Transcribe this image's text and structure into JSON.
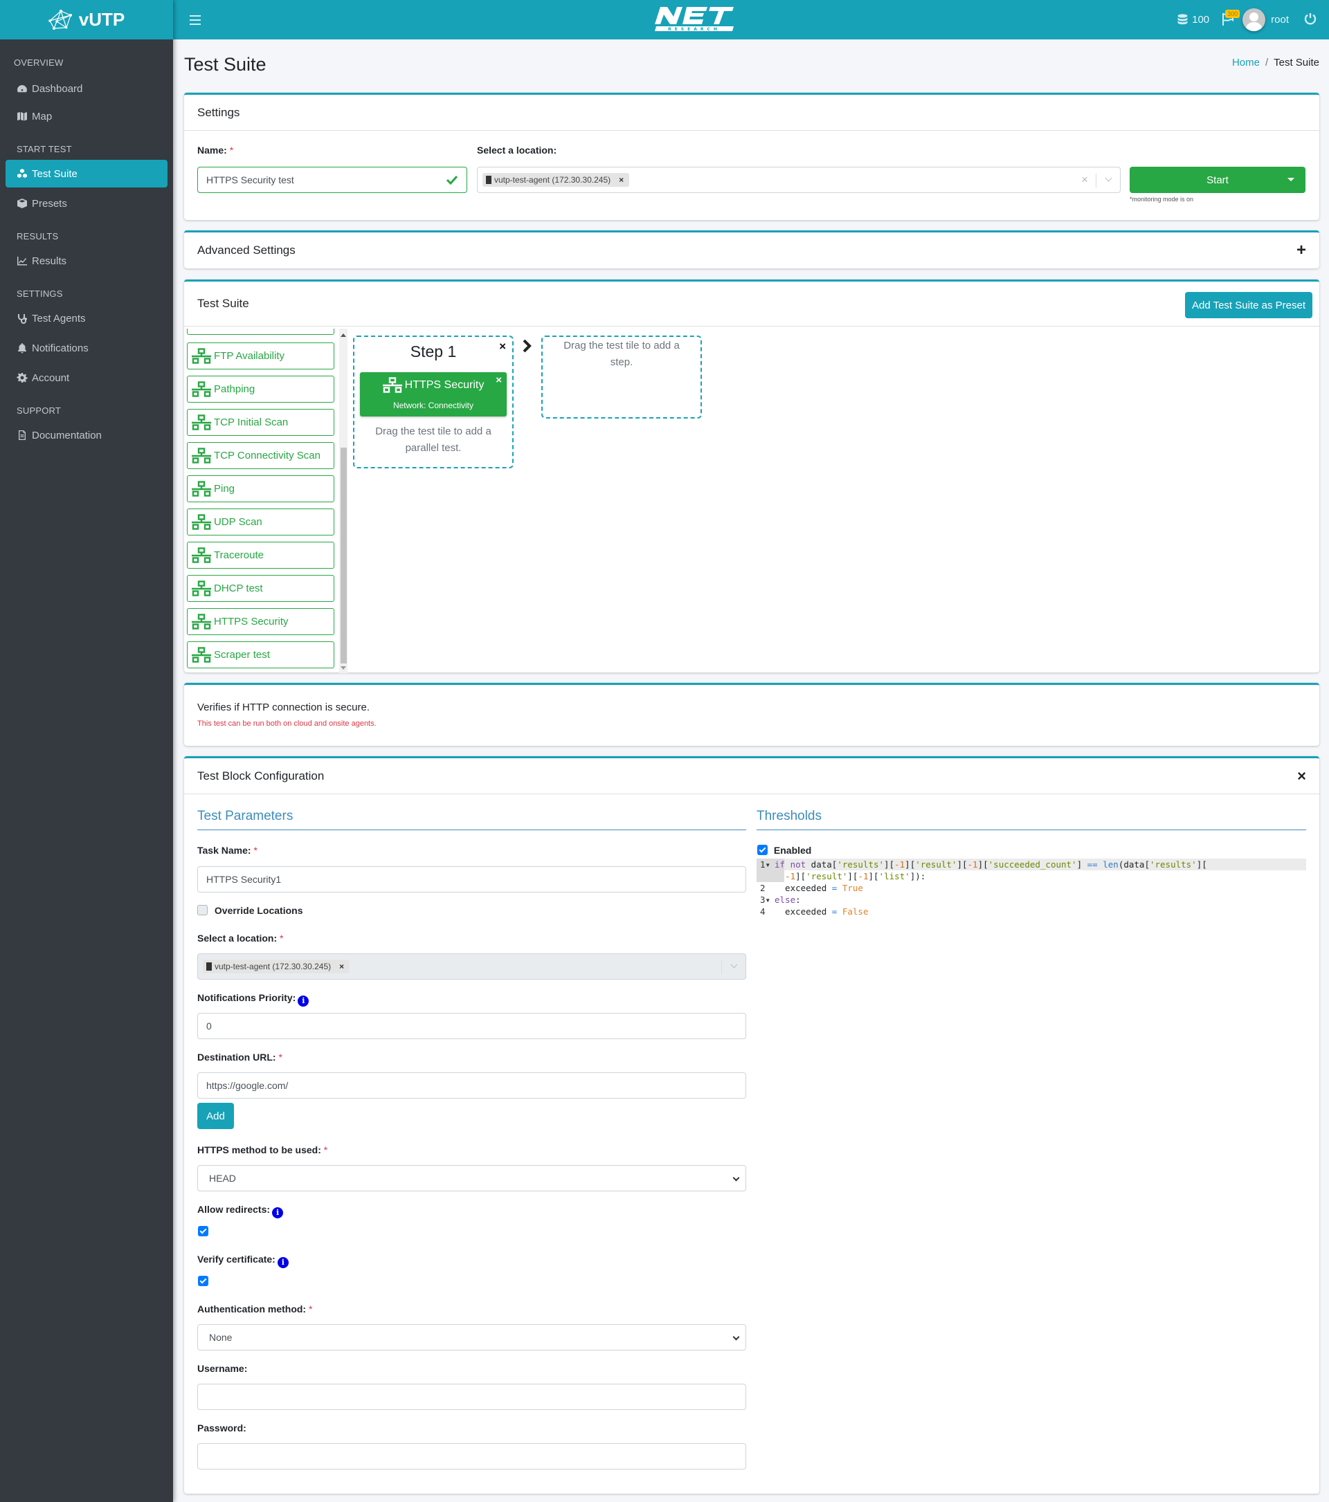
{
  "app": {
    "brand": "vUTP",
    "partner_logo_alt": "NET Research"
  },
  "header": {
    "menu_icon": "hamburger-icon",
    "credits": "100",
    "notifications_badge": "300",
    "user": "root"
  },
  "sidebar": {
    "sections": [
      {
        "title": "OVERVIEW",
        "items": [
          {
            "label": "Dashboard",
            "icon": "tachometer-icon"
          },
          {
            "label": "Map",
            "icon": "map-icon"
          }
        ]
      },
      {
        "title": "START TEST",
        "items": [
          {
            "label": "Test Suite",
            "icon": "cubes-icon",
            "active": true
          },
          {
            "label": "Presets",
            "icon": "box-icon"
          }
        ]
      },
      {
        "title": "RESULTS",
        "items": [
          {
            "label": "Results",
            "icon": "chart-line-icon"
          }
        ]
      },
      {
        "title": "SETTINGS",
        "items": [
          {
            "label": "Test Agents",
            "icon": "stethoscope-icon"
          },
          {
            "label": "Notifications",
            "icon": "bell-icon"
          },
          {
            "label": "Account",
            "icon": "cog-icon"
          }
        ]
      },
      {
        "title": "SUPPORT",
        "items": [
          {
            "label": "Documentation",
            "icon": "file-icon"
          }
        ]
      }
    ]
  },
  "page": {
    "title": "Test Suite",
    "breadcrumb": {
      "home": "Home",
      "separator": "/",
      "current": "Test Suite"
    }
  },
  "settings": {
    "title": "Settings",
    "name_label": "Name:",
    "name_value": "HTTPS Security test",
    "location_label": "Select a location:",
    "location_chip": "vutp-test-agent (172.30.30.245)",
    "start_label": "Start",
    "monitoring_note": "*monitoring mode is on"
  },
  "advanced": {
    "title": "Advanced Settings",
    "toggle": "+"
  },
  "suite": {
    "title": "Test Suite",
    "add_preset_label": "Add Test Suite as Preset",
    "tiles": [
      "FTP Availability",
      "Pathping",
      "TCP Initial Scan",
      "TCP Connectivity Scan",
      "Ping",
      "UDP Scan",
      "Traceroute",
      "DHCP test",
      "HTTPS Security",
      "Scraper test"
    ],
    "step": {
      "title": "Step 1",
      "test_name": "HTTPS Security",
      "test_category": "Network: Connectivity",
      "parallel_hint": "Drag the test tile to add a parallel test.",
      "close": "×"
    },
    "next_step_hint": "Drag the test tile to add a step."
  },
  "description": {
    "text": "Verifies if HTTP connection is secure.",
    "note": "This test can be run both on cloud and onsite agents."
  },
  "block": {
    "title": "Test Block Configuration",
    "close": "×",
    "params_title": "Test Parameters",
    "task_name_label": "Task Name:",
    "task_name_value": "HTTPS Security1",
    "override_label": "Override Locations",
    "override_checked": false,
    "location_label": "Select a location:",
    "location_chip": "vutp-test-agent (172.30.30.245)",
    "priority_label": "Notifications Priority:",
    "priority_value": "0",
    "url_label": "Destination URL:",
    "url_value": "https://google.com/",
    "add_label": "Add",
    "method_label": "HTTPS method to be used:",
    "method_value": "HEAD",
    "redirects_label": "Allow redirects:",
    "redirects_checked": true,
    "verify_label": "Verify certificate:",
    "verify_checked": true,
    "auth_label": "Authentication method:",
    "auth_value": "None",
    "username_label": "Username:",
    "username_value": "",
    "password_label": "Password:",
    "password_value": "",
    "thresholds_title": "Thresholds",
    "enabled_label": "Enabled",
    "enabled_checked": true,
    "code_lines": [
      "if not data['results'][-1]['result'][-1]['succeeded_count'] == len(data['results'][",
      "-1]['result'][-1]['list']):",
      "exceeded = True",
      "else:",
      "exceeded = False"
    ]
  },
  "colors": {
    "primary": "#17a2b8",
    "success": "#28a745",
    "sidebar": "#343a40",
    "danger": "#dc3545"
  }
}
